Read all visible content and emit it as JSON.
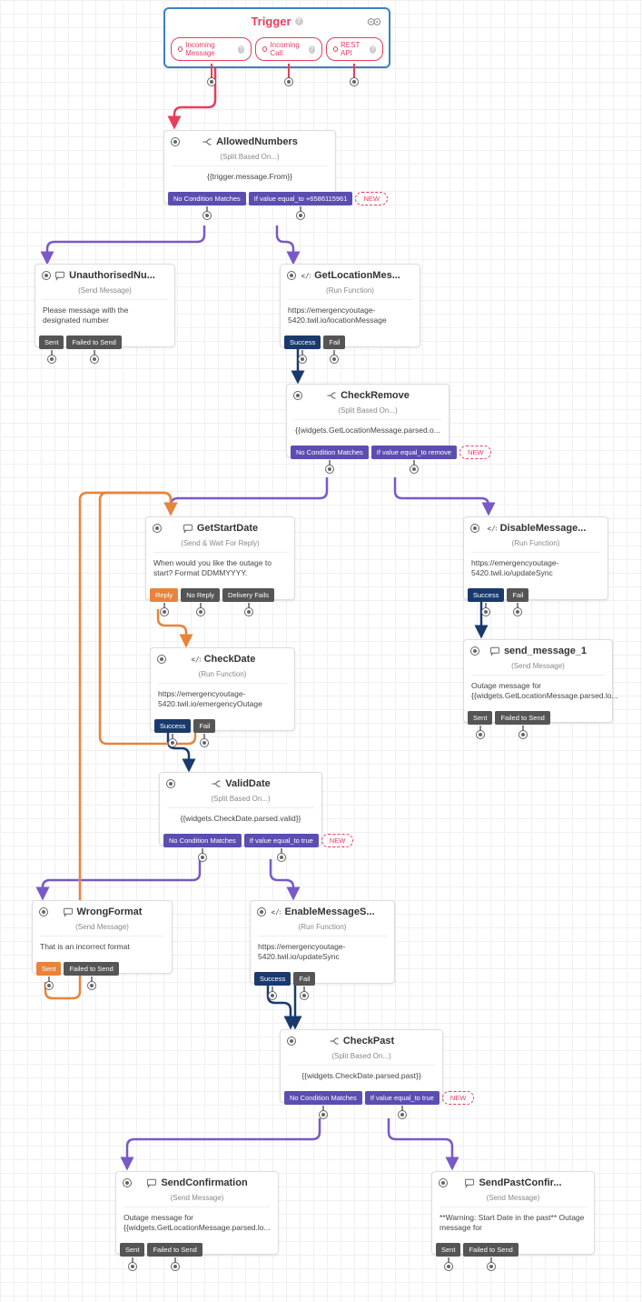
{
  "trigger": {
    "title": "Trigger",
    "pills": [
      "Incoming Message",
      "Incoming Call",
      "REST API"
    ]
  },
  "nodes": {
    "allowedNumbers": {
      "title": "AllowedNumbers",
      "sub": "(Split Based On...)",
      "body": "{{trigger.message.From}}",
      "conditions": [
        "No Condition Matches",
        "If value equal_to +6586115961"
      ],
      "new": "NEW"
    },
    "unauthorised": {
      "title": "UnauthorisedNu...",
      "sub": "(Send Message)",
      "body": "Please message with the designated number",
      "conditions": [
        "Sent",
        "Failed to Send"
      ]
    },
    "getLocation": {
      "title": "GetLocationMes...",
      "sub": "(Run Function)",
      "body": "https://emergencyoutage-5420.twil.io/locationMessage",
      "conditions": [
        "Success",
        "Fail"
      ]
    },
    "checkRemove": {
      "title": "CheckRemove",
      "sub": "(Split Based On...)",
      "body": "{{widgets.GetLocationMessage.parsed.o...",
      "conditions": [
        "No Condition Matches",
        "If value equal_to remove"
      ],
      "new": "NEW"
    },
    "getStartDate": {
      "title": "GetStartDate",
      "sub": "(Send & Wait For Reply)",
      "body": "When would you like the outage to start? Format DDMMYYYY.",
      "conditions": [
        "Reply",
        "No Reply",
        "Delivery Fails"
      ]
    },
    "disableMessage": {
      "title": "DisableMessage...",
      "sub": "(Run Function)",
      "body": "https://emergencyoutage-5420.twil.io/updateSync",
      "conditions": [
        "Success",
        "Fail"
      ]
    },
    "sendMessage1": {
      "title": "send_message_1",
      "sub": "(Send Message)",
      "body": "Outage message for {{widgets.GetLocationMessage.parsed.lo...",
      "conditions": [
        "Sent",
        "Failed to Send"
      ]
    },
    "checkDate": {
      "title": "CheckDate",
      "sub": "(Run Function)",
      "body": "https://emergencyoutage-5420.twil.io/emergencyOutage",
      "conditions": [
        "Success",
        "Fail"
      ]
    },
    "validDate": {
      "title": "ValidDate",
      "sub": "(Split Based On...)",
      "body": "{{widgets.CheckDate.parsed.valid}}",
      "conditions": [
        "No Condition Matches",
        "If value equal_to true"
      ],
      "new": "NEW"
    },
    "wrongFormat": {
      "title": "WrongFormat",
      "sub": "(Send Message)",
      "body": "That is an incorrect format",
      "conditions": [
        "Sent",
        "Failed to Send"
      ]
    },
    "enableMessage": {
      "title": "EnableMessageS...",
      "sub": "(Run Function)",
      "body": "https://emergencyoutage-5420.twil.io/updateSync",
      "conditions": [
        "Success",
        "Fail"
      ]
    },
    "checkPast": {
      "title": "CheckPast",
      "sub": "(Split Based On...)",
      "body": "{{widgets.CheckDate.parsed.past}}",
      "conditions": [
        "No Condition Matches",
        "If value equal_to true"
      ],
      "new": "NEW"
    },
    "sendConfirmation": {
      "title": "SendConfirmation",
      "sub": "(Send Message)",
      "body": "Outage message for {{widgets.GetLocationMessage.parsed.lo...",
      "conditions": [
        "Sent",
        "Failed to Send"
      ]
    },
    "sendPastConfir": {
      "title": "SendPastConfir...",
      "sub": "(Send Message)",
      "body": "**Warning: Start Date in the past** Outage message for",
      "conditions": [
        "Sent",
        "Failed to Send"
      ]
    }
  },
  "icons": {
    "split": "split-icon",
    "message": "message-icon",
    "function": "function-icon"
  }
}
